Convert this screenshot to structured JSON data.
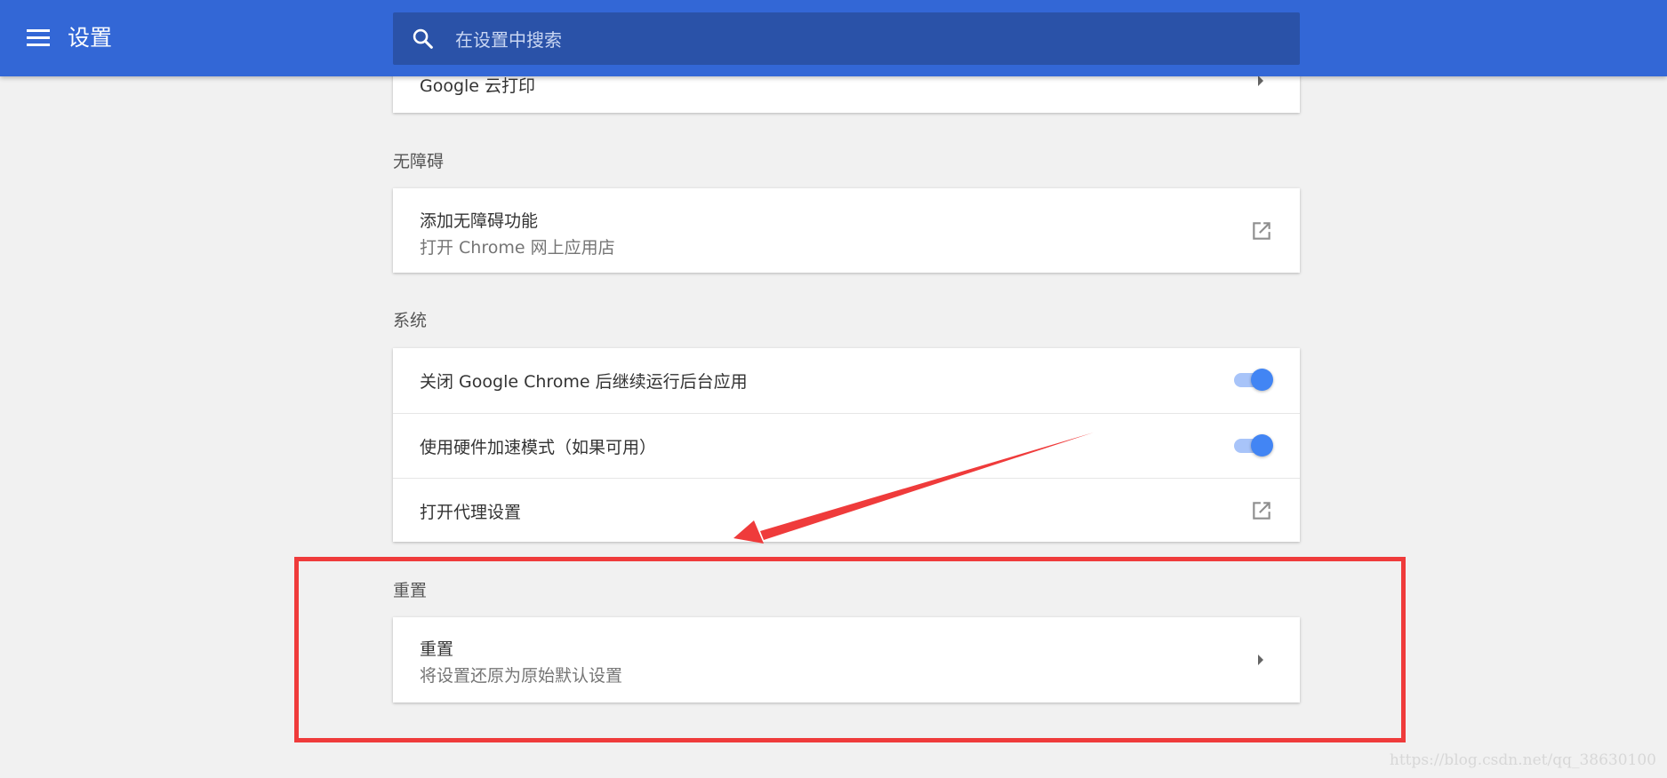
{
  "header": {
    "title": "设置",
    "search_placeholder": "在设置中搜索"
  },
  "sections": {
    "printing_partial": {
      "item_title": "Google 云打印"
    },
    "accessibility": {
      "title": "无障碍",
      "item_title": "添加无障碍功能",
      "item_subtitle": "打开 Chrome 网上应用店"
    },
    "system": {
      "title": "系统",
      "items": [
        {
          "label": "关闭 Google Chrome 后继续运行后台应用",
          "type": "toggle",
          "checked": true
        },
        {
          "label": "使用硬件加速模式（如果可用）",
          "type": "toggle",
          "checked": true
        },
        {
          "label": "打开代理设置",
          "type": "external-link"
        }
      ]
    },
    "reset": {
      "title": "重置",
      "item_title": "重置",
      "item_subtitle": "将设置还原为原始默认设置"
    }
  },
  "watermark": "https://blog.csdn.net/qq_38630100",
  "colors": {
    "toolbar": "#3367d6",
    "search_bg": "#2a52a8",
    "toggle_knob": "#4285f4",
    "annotation": "#ef3b3b"
  }
}
